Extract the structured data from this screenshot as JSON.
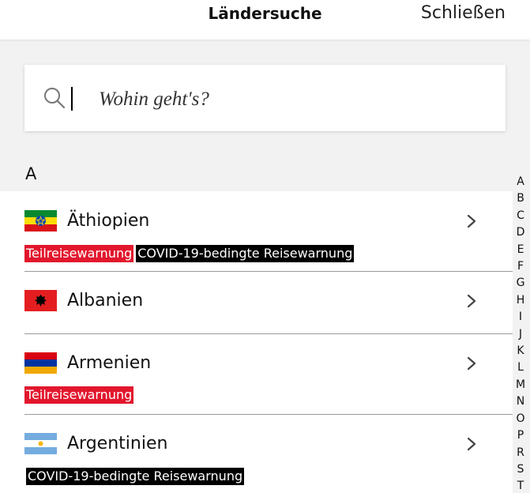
{
  "header": {
    "title": "Ländersuche",
    "close_label": "Schließen"
  },
  "search": {
    "placeholder": "Wohin geht's?",
    "value": ""
  },
  "section": {
    "letter": "A"
  },
  "countries": [
    {
      "name": "Äthiopien",
      "flag": "ethiopia-flag",
      "badges": [
        {
          "text": "Teilreisewarnung",
          "color": "#e2172d"
        },
        {
          "text": "COVID-19-bedingte Reisewarnung",
          "color": "#000000"
        }
      ]
    },
    {
      "name": "Albanien",
      "flag": "albania-flag",
      "badges": []
    },
    {
      "name": "Armenien",
      "flag": "armenia-flag",
      "badges": [
        {
          "text": "Teilreisewarnung",
          "color": "#e2172d"
        }
      ]
    },
    {
      "name": "Argentinien",
      "flag": "argentina-flag",
      "badges": [
        {
          "text": "COVID-19-bedingte Reisewarnung",
          "color": "#000000"
        }
      ]
    }
  ],
  "alphabet_index": [
    "A",
    "B",
    "C",
    "D",
    "E",
    "F",
    "G",
    "H",
    "I",
    "J",
    "K",
    "L",
    "M",
    "N",
    "O",
    "P",
    "R",
    "S",
    "T"
  ],
  "colors": {
    "warning_red": "#e2172d",
    "covid_black": "#000000",
    "background": "#f2f2f2"
  }
}
